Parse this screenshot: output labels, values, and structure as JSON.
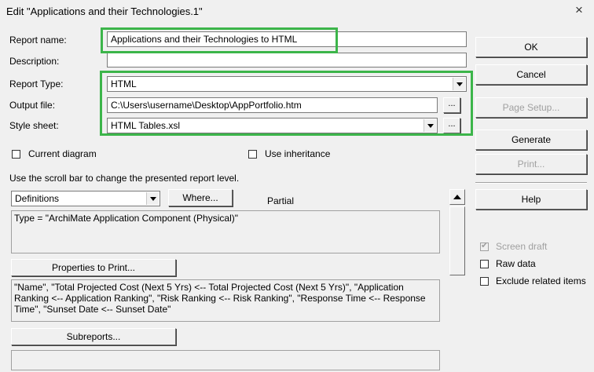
{
  "window": {
    "title": "Edit \"Applications and their Technologies.1\"",
    "close_glyph": "×"
  },
  "form": {
    "report_name_label": "Report name:",
    "report_name_value": "Applications and their Technologies to HTML",
    "description_label": "Description:",
    "description_value": "",
    "report_type_label": "Report Type:",
    "report_type_value": "HTML",
    "output_file_label": "Output file:",
    "output_file_value": "C:\\Users\\username\\Desktop\\AppPortfolio.htm",
    "style_sheet_label": "Style sheet:",
    "style_sheet_value": "HTML Tables.xsl",
    "browse_label": "...",
    "current_diagram_label": "Current diagram",
    "use_inheritance_label": "Use inheritance",
    "scroll_hint": "Use the scroll bar to change the presented report level.",
    "level_select_value": "Definitions",
    "where_button": "Where...",
    "partial_label": "Partial",
    "type_filter_text": "Type = \"ArchiMate Application Component (Physical)\"",
    "properties_button": "Properties to Print...",
    "properties_text": "\"Name\", \"Total Projected Cost (Next 5 Yrs) <-- Total Projected Cost (Next 5 Yrs)\", \"Application Ranking <-- Application Ranking\", \"Risk Ranking <-- Risk Ranking\", \"Response Time <-- Response Time\", \"Sunset Date <-- Sunset Date\"",
    "subreports_button": "Subreports...",
    "subreports_text": ""
  },
  "buttons": {
    "ok": "OK",
    "cancel": "Cancel",
    "page_setup": "Page Setup...",
    "generate": "Generate",
    "print": "Print...",
    "help": "Help"
  },
  "options": {
    "screen_draft_label": "Screen draft",
    "screen_draft_checked": true,
    "raw_data_label": "Raw data",
    "exclude_related_label": "Exclude related items"
  },
  "colors": {
    "highlight": "#3cb54a",
    "dialog_bg": "#f0f0f0",
    "disabled_text": "#a0a0a0"
  }
}
